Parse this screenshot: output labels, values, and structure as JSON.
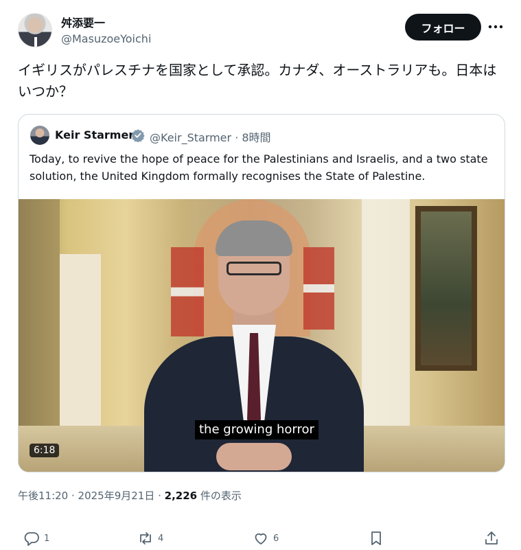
{
  "author": {
    "name": "舛添要一",
    "handle": "@MasuzoeYoichi"
  },
  "follow_label": "フォロー",
  "tweet_text": "イギリスがパレスチナを国家として承認。カナダ、オーストラリアも。日本はいつか？",
  "quote": {
    "name": "Keir Starmer",
    "handle_time": "@Keir_Starmer · 8時間",
    "text": "Today, to revive the hope of peace for the Palestinians and Israelis, and a two state solution, the United Kingdom formally recognises the State of Palestine.",
    "video": {
      "caption": "the growing horror",
      "duration": "6:18"
    }
  },
  "meta": {
    "time_date": "午後11:20 · 2025年9月21日 · ",
    "views": "2,226",
    "views_label": " 件の表示"
  },
  "actions": {
    "reply_count": "1",
    "repost_count": "4",
    "like_count": "6"
  },
  "colors": {
    "text": "#0f1419",
    "muted": "#536471",
    "border": "#cfd9de",
    "verified": "#829aab"
  }
}
